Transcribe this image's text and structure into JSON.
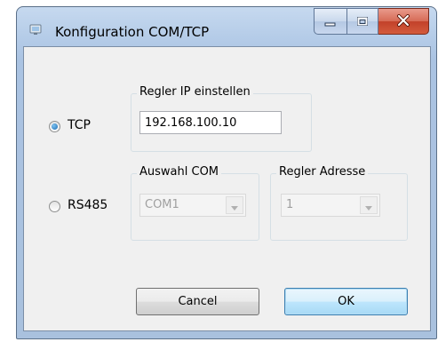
{
  "window": {
    "title": "Konfiguration COM/TCP"
  },
  "caption": {
    "min": "minimize-icon",
    "max": "maximize-icon",
    "close": "close-icon"
  },
  "tcp": {
    "label": "TCP",
    "checked": true
  },
  "rs485": {
    "label": "RS485",
    "checked": false
  },
  "ip_group": {
    "legend": "Regler IP einstellen",
    "value": "192.168.100.10"
  },
  "com_group": {
    "legend": "Auswahl COM",
    "selected": "COM1"
  },
  "addr_group": {
    "legend": "Regler Adresse",
    "selected": "1"
  },
  "buttons": {
    "cancel": "Cancel",
    "ok": "OK"
  },
  "colors": {
    "selected_radio": "#1d6cb2",
    "close_button": "#c2412a"
  }
}
